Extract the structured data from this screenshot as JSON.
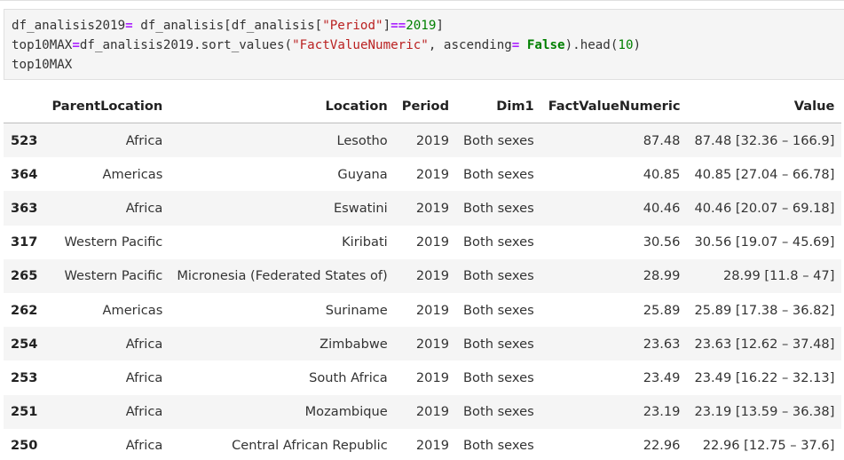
{
  "code": {
    "line1": {
      "a": "df_analisis2019",
      "b": "=",
      "c": " df_analisis[df_analisis[",
      "d": "\"Period\"",
      "e": "]",
      "f": "==",
      "g": "2019",
      "h": "]"
    },
    "line2": {
      "a": "top10MAX",
      "b": "=",
      "c": "df_analisis2019",
      "d": ".",
      "e": "sort_values",
      "f": "(",
      "g": "\"FactValueNumeric\"",
      "h": ", ascending",
      "i": "=",
      "j": " False",
      "k": ").",
      "l": "head",
      "m": "(",
      "n": "10",
      "o": ")"
    },
    "line3": "top10MAX"
  },
  "table": {
    "headers": {
      "index": "",
      "parent": "ParentLocation",
      "location": "Location",
      "period": "Period",
      "dim1": "Dim1",
      "fact": "FactValueNumeric",
      "value": "Value"
    },
    "rows": [
      {
        "index": "523",
        "parent": "Africa",
        "location": "Lesotho",
        "period": "2019",
        "dim1": "Both sexes",
        "fact": "87.48",
        "value": "87.48 [32.36 – 166.9]"
      },
      {
        "index": "364",
        "parent": "Americas",
        "location": "Guyana",
        "period": "2019",
        "dim1": "Both sexes",
        "fact": "40.85",
        "value": "40.85 [27.04 – 66.78]"
      },
      {
        "index": "363",
        "parent": "Africa",
        "location": "Eswatini",
        "period": "2019",
        "dim1": "Both sexes",
        "fact": "40.46",
        "value": "40.46 [20.07 – 69.18]"
      },
      {
        "index": "317",
        "parent": "Western Pacific",
        "location": "Kiribati",
        "period": "2019",
        "dim1": "Both sexes",
        "fact": "30.56",
        "value": "30.56 [19.07 – 45.69]"
      },
      {
        "index": "265",
        "parent": "Western Pacific",
        "location": "Micronesia (Federated States of)",
        "period": "2019",
        "dim1": "Both sexes",
        "fact": "28.99",
        "value": "28.99 [11.8 – 47]"
      },
      {
        "index": "262",
        "parent": "Americas",
        "location": "Suriname",
        "period": "2019",
        "dim1": "Both sexes",
        "fact": "25.89",
        "value": "25.89 [17.38 – 36.82]"
      },
      {
        "index": "254",
        "parent": "Africa",
        "location": "Zimbabwe",
        "period": "2019",
        "dim1": "Both sexes",
        "fact": "23.63",
        "value": "23.63 [12.62 – 37.48]"
      },
      {
        "index": "253",
        "parent": "Africa",
        "location": "South Africa",
        "period": "2019",
        "dim1": "Both sexes",
        "fact": "23.49",
        "value": "23.49 [16.22 – 32.13]"
      },
      {
        "index": "251",
        "parent": "Africa",
        "location": "Mozambique",
        "period": "2019",
        "dim1": "Both sexes",
        "fact": "23.19",
        "value": "23.19 [13.59 – 36.38]"
      },
      {
        "index": "250",
        "parent": "Africa",
        "location": "Central African Republic",
        "period": "2019",
        "dim1": "Both sexes",
        "fact": "22.96",
        "value": "22.96 [12.75 – 37.6]"
      }
    ]
  }
}
